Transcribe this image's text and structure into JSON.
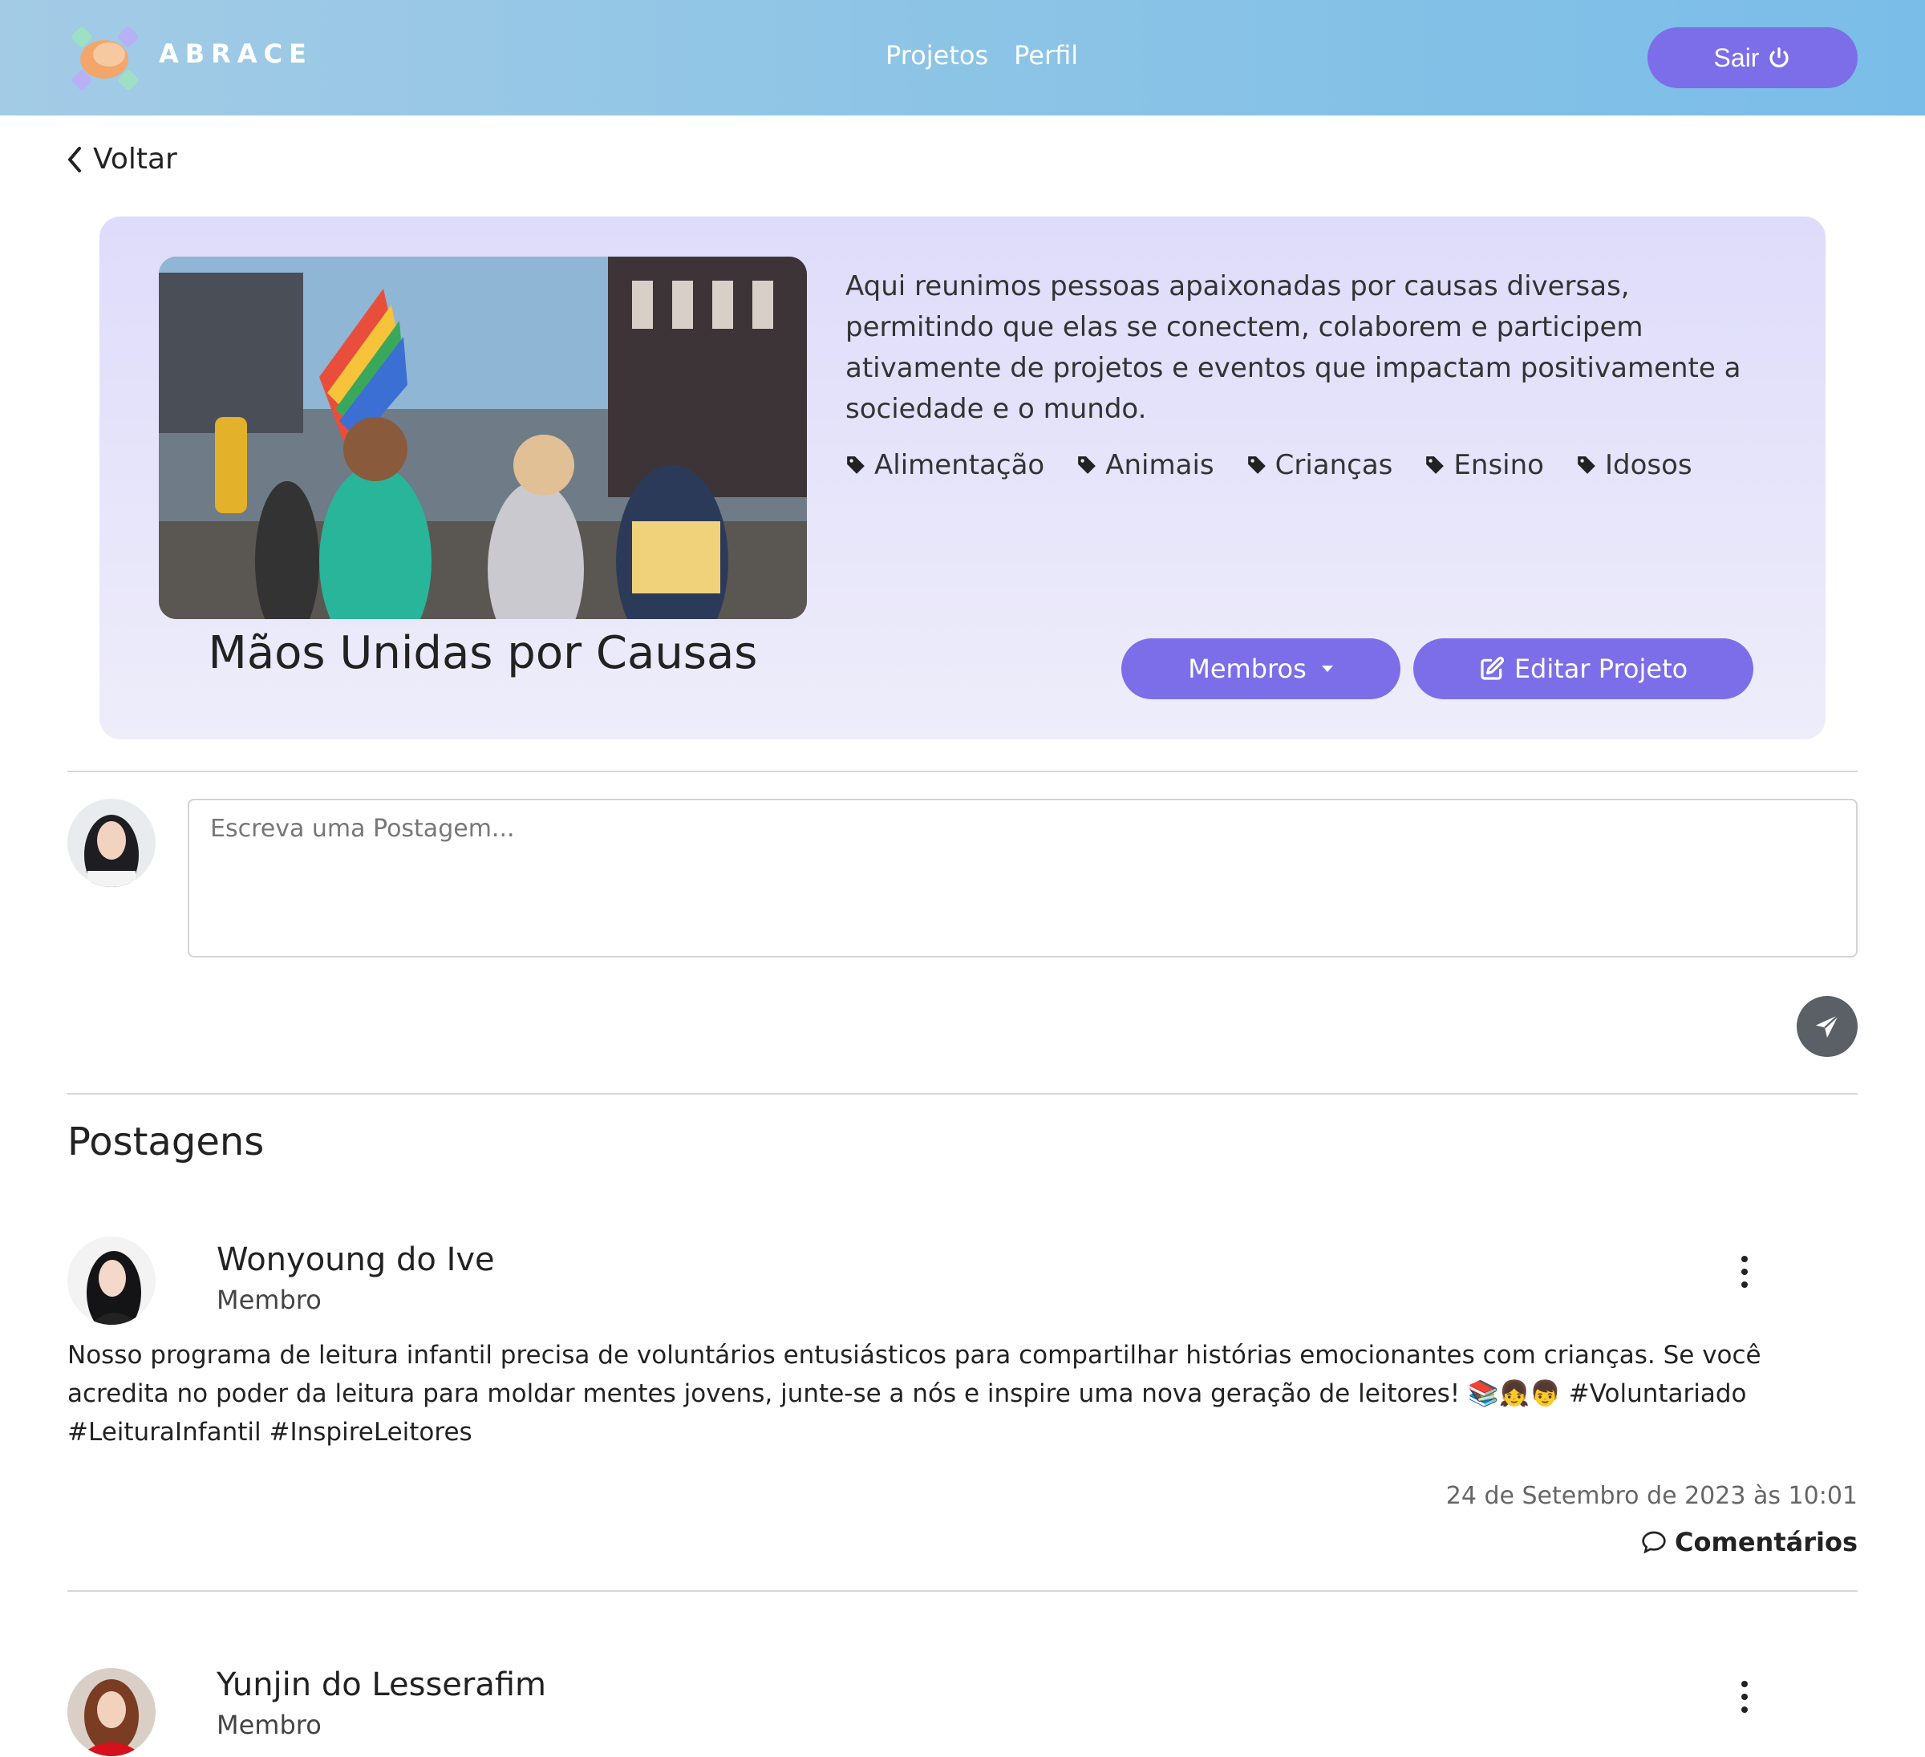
{
  "header": {
    "brand": "ABRACE",
    "nav": [
      "Projetos",
      "Perfil"
    ],
    "logout_label": "Sair"
  },
  "back_label": "Voltar",
  "project": {
    "title": "Mãos Unidas por Causas",
    "description": "Aqui reunimos pessoas apaixonadas por causas diversas, permitindo que elas se conectem, colaborem e participem ativamente de projetos e eventos que impactam positivamente a sociedade e o mundo.",
    "tags": [
      "Alimentação",
      "Animais",
      "Crianças",
      "Ensino",
      "Idosos"
    ],
    "members_label": "Membros",
    "edit_label": "Editar Projeto"
  },
  "composer": {
    "placeholder": "Escreva uma Postagem..."
  },
  "posts_title": "Postagens",
  "posts": [
    {
      "author": "Wonyoung do Ive",
      "role": "Membro",
      "body": "Nosso programa de leitura infantil precisa de voluntários entusiásticos para compartilhar histórias emocionantes com crianças. Se você acredita no poder da leitura para moldar mentes jovens, junte-se a nós e inspire uma nova geração de leitores! 📚👧👦 #Voluntariado #LeituraInfantil #InspireLeitores",
      "date": "24 de Setembro de 2023 às 10:01",
      "comments_label": "Comentários"
    },
    {
      "author": "Yunjin do Lesserafim",
      "role": "Membro"
    }
  ],
  "colors": {
    "accent": "#7b6ee8",
    "header_start": "#a3cbe6",
    "header_end": "#7abde8",
    "card_bg": "#dedcfa"
  }
}
